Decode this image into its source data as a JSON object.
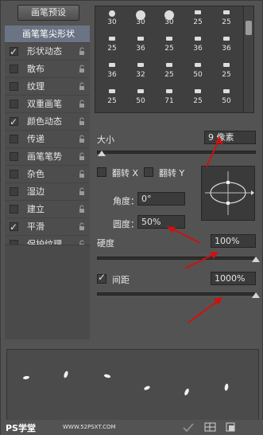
{
  "preset_button": "画笔预设",
  "sidebar": {
    "items": [
      {
        "label": "画笔笔尖形状",
        "checked": false,
        "header": true,
        "active": true
      },
      {
        "label": "形状动态",
        "checked": true
      },
      {
        "label": "散布",
        "checked": false
      },
      {
        "label": "纹理",
        "checked": false
      },
      {
        "label": "双重画笔",
        "checked": false
      },
      {
        "label": "颜色动态",
        "checked": true
      },
      {
        "label": "传递",
        "checked": false
      },
      {
        "label": "画笔笔势",
        "checked": false
      },
      {
        "label": "杂色",
        "checked": false
      },
      {
        "label": "湿边",
        "checked": false
      },
      {
        "label": "建立",
        "checked": false
      },
      {
        "label": "平滑",
        "checked": true
      },
      {
        "label": "保护纹理",
        "checked": false
      }
    ]
  },
  "brush_grid": {
    "rows": [
      [
        "30",
        "30",
        "30",
        "25",
        "25"
      ],
      [
        "25",
        "36",
        "25",
        "36",
        "36"
      ],
      [
        "36",
        "32",
        "25",
        "50",
        "25"
      ],
      [
        "25",
        "50",
        "71",
        "25",
        "50"
      ]
    ]
  },
  "size": {
    "label": "大小",
    "value": "9 像素",
    "level": 0.03
  },
  "flip": {
    "x_label": "翻转 X",
    "y_label": "翻转 Y"
  },
  "angle": {
    "label": "角度：",
    "value": "0°"
  },
  "roundness": {
    "label": "圆度：",
    "value": "50%"
  },
  "hardness": {
    "label": "硬度",
    "value": "100%",
    "level": 1.0
  },
  "spacing": {
    "label": "间距",
    "value": "1000%",
    "checked": true,
    "level": 1.0
  },
  "watermark": {
    "left": "PS学堂",
    "right": "WWW.52PSXT.COM"
  },
  "colors": {
    "arrow": "#d01010",
    "accent": "#6b7484"
  }
}
